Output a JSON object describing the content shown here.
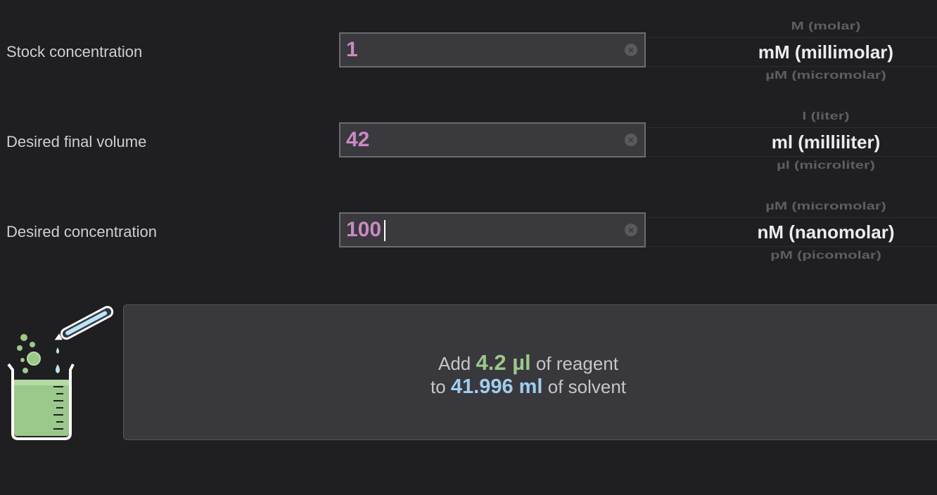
{
  "rows": [
    {
      "label": "Stock concentration",
      "value": "1",
      "unit_prev": "M (molar)",
      "unit_selected": "mM (millimolar)",
      "unit_next": "µM (micromolar)"
    },
    {
      "label": "Desired final volume",
      "value": "42",
      "unit_prev": "l (liter)",
      "unit_selected": "ml (milliliter)",
      "unit_next": "µl (microliter)"
    },
    {
      "label": "Desired concentration",
      "value": "100",
      "unit_prev": "µM (micromolar)",
      "unit_selected": "nM (nanomolar)",
      "unit_next": "pM (picomolar)"
    }
  ],
  "result": {
    "add_word": "Add",
    "reagent_amount": "4.2 µl",
    "reagent_suffix": "of reagent",
    "to_word": "to",
    "solvent_amount": "41.996 ml",
    "solvent_suffix": "of solvent"
  },
  "colors": {
    "background": "#1f1f21",
    "input_text": "#c88ac2",
    "reagent_green": "#9bc88b",
    "solvent_blue": "#9fcdf0"
  },
  "icons": {
    "illustration": "beaker-pipette-icon",
    "clear": "clear-circle-icon"
  }
}
